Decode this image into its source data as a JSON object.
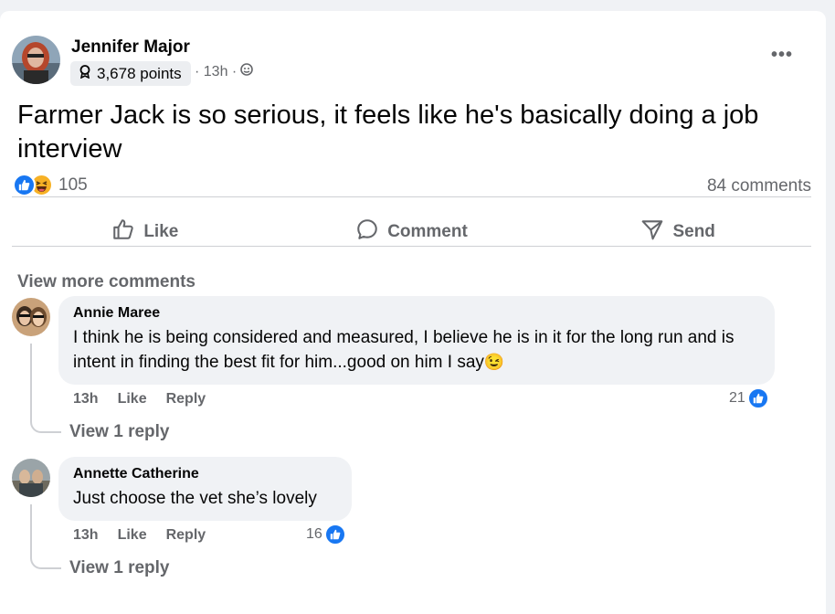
{
  "post": {
    "author": "Jennifer Major",
    "points": "3,678 points",
    "time": "· 13h ·",
    "text": "Farmer Jack is so serious, it feels like he's basically doing a job interview",
    "reaction_count": "105",
    "comments_label": "84 comments"
  },
  "actions": {
    "like": "Like",
    "comment": "Comment",
    "send": "Send"
  },
  "view_more_comments": "View more comments",
  "comments": [
    {
      "name": "Annie Maree",
      "text": "I think he is being considered and measured, I believe he is in it for the long run and is intent in finding the best fit for him...good on him I say",
      "emoji": "😉",
      "time": "13h",
      "like": "Like",
      "reply": "Reply",
      "likes": "21",
      "view_reply": "View 1 reply"
    },
    {
      "name": "Annette Catherine",
      "text": "Just choose the vet she’s lovely",
      "time": "13h",
      "like": "Like",
      "reply": "Reply",
      "likes": "16",
      "view_reply": "View 1 reply"
    }
  ],
  "icons": {
    "like_reaction": "thumbs-up-icon",
    "haha_reaction": "laughing-face-icon",
    "points_badge": "award-icon",
    "audience": "globe-icon",
    "more": "more-icon",
    "comment": "comment-icon",
    "send": "send-icon"
  },
  "colors": {
    "accent": "#1877f2",
    "secondary_text": "#65676b",
    "bubble": "#f0f2f5",
    "haha": "#f7b125"
  }
}
